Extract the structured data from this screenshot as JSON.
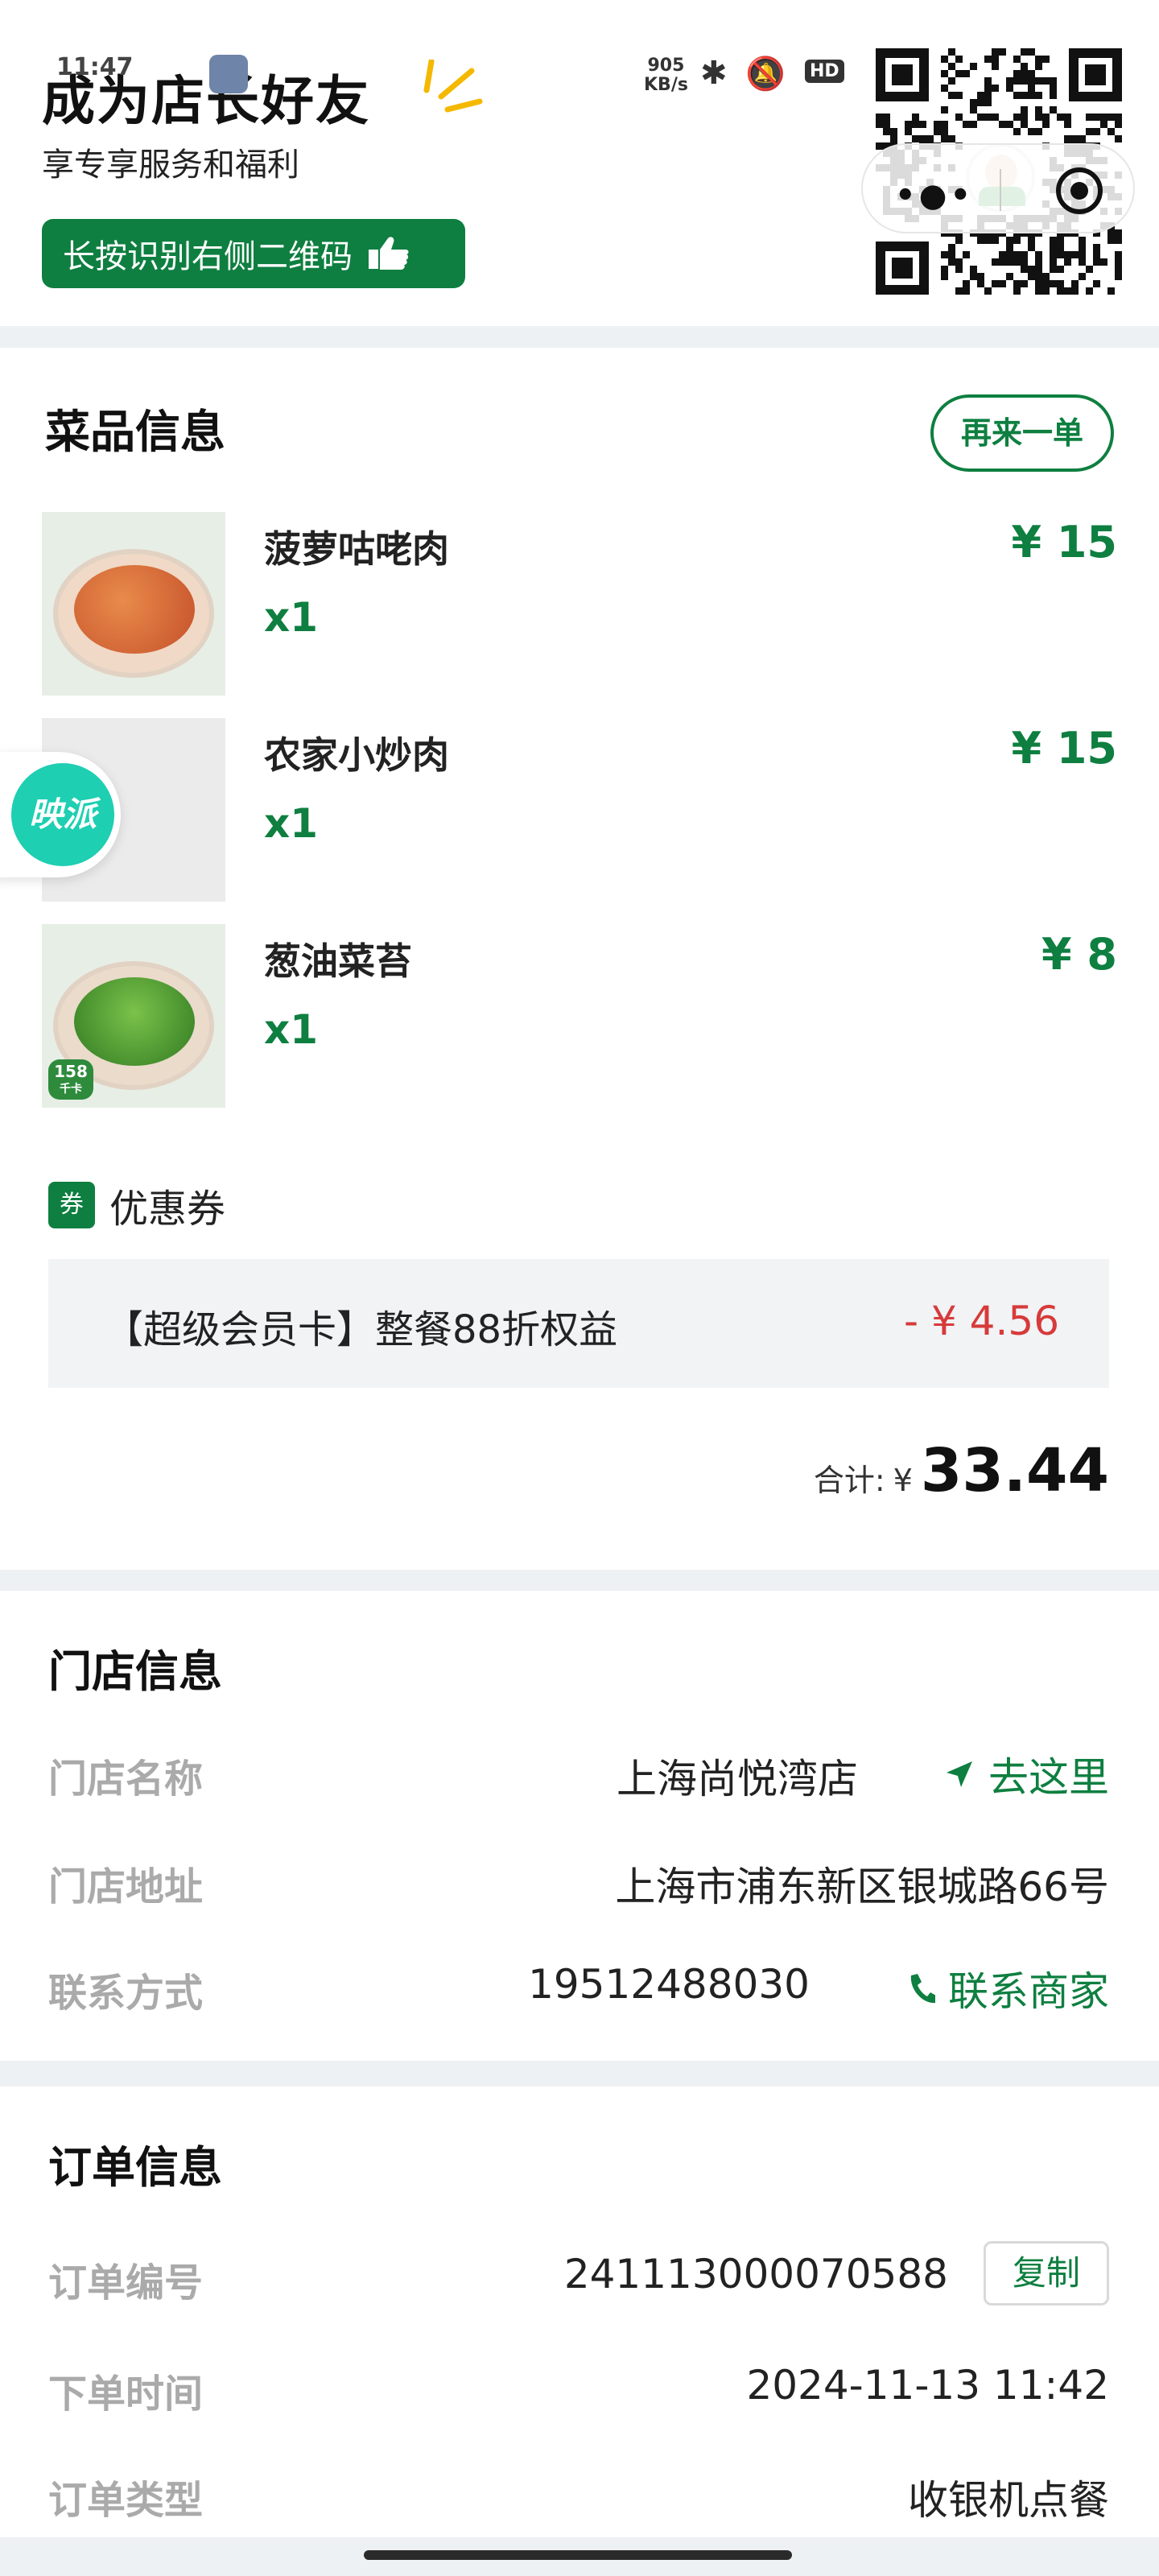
{
  "status_bar": {
    "time": "11:47",
    "speed_value": "905",
    "speed_unit": "KB/s",
    "hd": "HD"
  },
  "promo": {
    "title": "成为店长好友",
    "subtitle": "享专享服务和福利",
    "button_label": "长按识别右侧二维码"
  },
  "dish_section": {
    "title": "菜品信息",
    "reorder_label": "再来一单",
    "dishes": [
      {
        "name": "菠萝咕咾肉",
        "qty": "x1",
        "price": "¥ 15"
      },
      {
        "name": "农家小炒肉",
        "qty": "x1",
        "price": "¥ 15"
      },
      {
        "name": "葱油菜苔",
        "qty": "x1",
        "price": "¥ 8"
      }
    ],
    "badge_158": "158",
    "badge_158_unit": "千卡",
    "coupon_tag": "券",
    "coupon_label": "优惠券",
    "coupon_name": "【超级会员卡】整餐88折权益",
    "coupon_amount": "- ¥ 4.56",
    "total_label": "合计:",
    "total_currency": "¥",
    "total_value": "33.44"
  },
  "store_section": {
    "title": "门店信息",
    "name_key": "门店名称",
    "name_value": "上海尚悦湾店",
    "nav_label": "去这里",
    "address_key": "门店地址",
    "address_value": "上海市浦东新区银城路66号",
    "contact_key": "联系方式",
    "contact_value": "19512488030",
    "contact_label": "联系商家"
  },
  "order_section": {
    "title": "订单信息",
    "number_key": "订单编号",
    "number_value": "241113000070588",
    "copy_label": "复制",
    "time_key": "下单时间",
    "time_value": "2024-11-13 11:42",
    "type_key": "订单类型",
    "type_value": "收银机点餐"
  },
  "side_float": {
    "label": "映派"
  },
  "colors": {
    "brand_green": "#0E7F40",
    "discount_red": "#D73A3A",
    "label_gray": "#AAAAAA",
    "page_bg": "#EDF1F4"
  }
}
